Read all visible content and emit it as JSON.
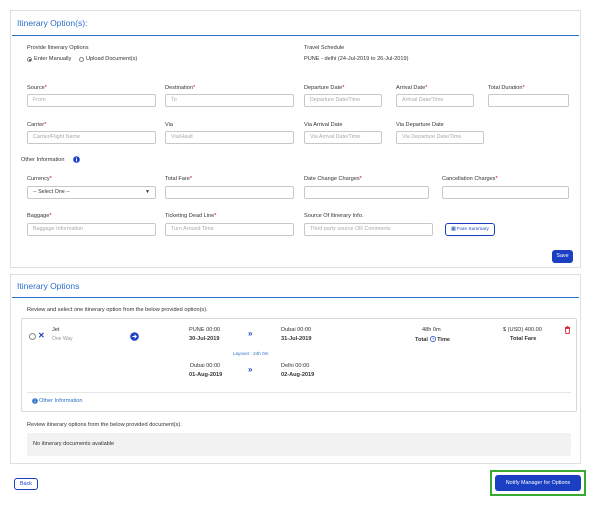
{
  "itinerary_form": {
    "title": "Itinerary Option(s):",
    "provide_label": "Provide Itinerary Options",
    "enter_manually": "Enter Manually",
    "upload_documents": "Upload Document(s)",
    "travel_schedule_label": "Travel Schedule",
    "travel_schedule_value": "PUNE - delhi (24-Jul-2019 to 26-Jul-2019)",
    "source_label": "Source",
    "source_placeholder": "From",
    "destination_label": "Destination",
    "destination_placeholder": "To",
    "departure_date_label": "Departure Date",
    "departure_date_placeholder": "Departure Date/Time",
    "arrival_date_label": "Arrival Date",
    "arrival_date_placeholder": "Arrival Date/Time",
    "total_duration_label": "Total Duration",
    "carrier_label": "Carrier",
    "carrier_placeholder": "Carrier/Flight Name",
    "via_label": "Via",
    "via_placeholder": "Via/Hault",
    "via_arrival_label": "Via Arrival Date",
    "via_arrival_placeholder": "Via Arrival Date/Time",
    "via_departure_label": "Via Departure Date",
    "via_departure_placeholder": "Via Departure Date/Time",
    "other_information_label": "Other Information",
    "currency_label": "Currency",
    "currency_value": "-- Select One --",
    "total_fare_label": "Total Fare",
    "date_change_label": "Date Change Charges",
    "cancellation_label": "Cancellation Charges",
    "baggage_label": "Baggage",
    "baggage_placeholder": "Baggage Information",
    "ticketing_label": "Ticketing Dead Line",
    "ticketing_placeholder": "Turn Around Time",
    "source_info_label": "Source Of Itinerary Info.",
    "source_info_placeholder": "Third party source OR Comments",
    "fare_summary": "Fare Summary",
    "save": "Save"
  },
  "itinerary_options": {
    "title": "Itinerary Options",
    "instructions": "Review and select one itinerary option from the below provided option(s).",
    "option": {
      "airline": "Jet",
      "trip_type": "One Way",
      "leg1_from_time": "PUNE 00:00",
      "leg1_from_date": "30-Jul-2019",
      "leg1_to_time": "Dubai 00:00",
      "leg1_to_date": "31-Jul-2019",
      "layover": "Layover : 24h 0m",
      "leg2_from_time": "Dubai 00:00",
      "leg2_from_date": "01-Aug-2019",
      "leg2_to_time": "Delhi 00:00",
      "leg2_to_date": "02-Aug-2019",
      "duration": "48h 0m",
      "total_time": "Total",
      "time_word": "Time",
      "fare": "$ (USD) 400.00",
      "fare_label": "Total Fare",
      "other_information": "Other Information"
    },
    "docs_instructions": "Review itinerary options from the below provided document(s).",
    "no_docs": "No itinerary documents available"
  },
  "footer": {
    "back": "Back",
    "notify": "Notify Manager for Options"
  },
  "colors": {
    "accent": "#2a6fc9",
    "primary_button": "#1a3fc3",
    "required": "#d0021b",
    "highlight_border": "#3aaa35"
  }
}
